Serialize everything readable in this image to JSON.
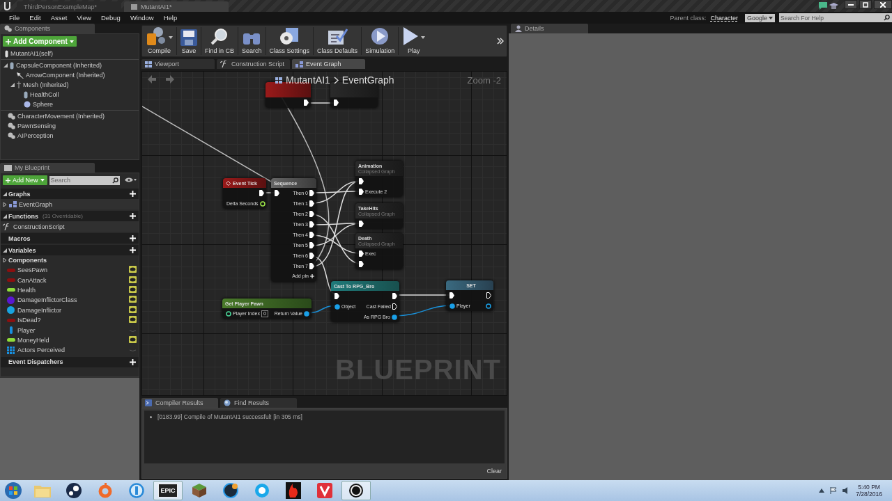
{
  "title_bar": {
    "tabs": [
      {
        "label": "ThirdPersonExampleMap*",
        "selected": false
      },
      {
        "label": "MutantAI1*",
        "selected": true
      }
    ]
  },
  "menu": [
    "File",
    "Edit",
    "Asset",
    "View",
    "Debug",
    "Window",
    "Help"
  ],
  "parent_class": {
    "label": "Parent class:",
    "value": "Character"
  },
  "help_search": {
    "provider": "Google",
    "placeholder": "Search For Help"
  },
  "components": {
    "tab": "Components",
    "add_button": "Add Component",
    "self": {
      "label": "MutantAI1(self)",
      "kind": "actor"
    },
    "scene_tree": [
      {
        "label": "CapsuleComponent (Inherited)",
        "kind": "capsule",
        "expanded": true,
        "children": [
          {
            "label": "ArrowComponent (Inherited)",
            "kind": "arrow"
          },
          {
            "label": "Mesh (Inherited)",
            "kind": "mesh",
            "expanded": true,
            "children": [
              {
                "label": "HealthColl",
                "kind": "capsule"
              },
              {
                "label": "Sphere",
                "kind": "sphere"
              }
            ]
          }
        ]
      }
    ],
    "other": [
      {
        "label": "CharacterMovement (Inherited)",
        "kind": "gear"
      },
      {
        "label": "PawnSensing",
        "kind": "gear"
      },
      {
        "label": "AIPerception",
        "kind": "gear"
      }
    ]
  },
  "my_blueprint": {
    "tab": "My Blueprint",
    "add_button": "Add New",
    "search_placeholder": "Search",
    "sections": [
      {
        "title": "Graphs",
        "expanded": true,
        "items": [
          {
            "label": "EventGraph",
            "kind": "graph",
            "expanded": false
          }
        ]
      },
      {
        "title": "Functions",
        "note": "(31 Overridable)",
        "expanded": true,
        "items": [
          {
            "label": "ConstructionScript",
            "kind": "function"
          }
        ]
      },
      {
        "title": "Macros"
      },
      {
        "title": "Variables",
        "expanded": true,
        "category": {
          "title": "Components",
          "expanded": false
        },
        "variables": [
          {
            "name": "SeesPawn",
            "kind": "pill",
            "color": "#8a1010",
            "public": true
          },
          {
            "name": "CanAttack",
            "kind": "pill",
            "color": "#8a1010",
            "public": true
          },
          {
            "name": "Health",
            "kind": "pill",
            "color": "#8fdc3a",
            "public": true
          },
          {
            "name": "DamageInflictorClass",
            "kind": "dot",
            "color": "#5a18d0",
            "public": true
          },
          {
            "name": "DamageInflictor",
            "kind": "dot",
            "color": "#18a4e0",
            "public": true
          },
          {
            "name": "IsDead?",
            "kind": "pill",
            "color": "#8a1010",
            "public": true
          },
          {
            "name": "Player",
            "kind": "capsule",
            "color": "#1890e0",
            "public": false
          },
          {
            "name": "MoneyHeld",
            "kind": "pill",
            "color": "#8fdc3a",
            "public": true
          },
          {
            "name": "Actors Perceived",
            "kind": "array",
            "color": "#1890e0",
            "public": false
          }
        ]
      },
      {
        "title": "Event Dispatchers"
      }
    ]
  },
  "toolbar": [
    {
      "label": "Compile",
      "kind": "compile",
      "dropdown": true
    },
    {
      "label": "Save",
      "kind": "save",
      "dropdown": false
    },
    {
      "label": "Find in CB",
      "kind": "find",
      "dropdown": false
    },
    {
      "label": "Search",
      "kind": "binoculars",
      "dropdown": false
    },
    {
      "label": "Class Settings",
      "kind": "settings",
      "dropdown": false
    },
    {
      "label": "Class Defaults",
      "kind": "defaults",
      "dropdown": false
    },
    {
      "label": "Simulation",
      "kind": "simulation",
      "dropdown": false
    },
    {
      "label": "Play",
      "kind": "play",
      "dropdown": true
    }
  ],
  "graph_tabs": [
    {
      "label": "Viewport",
      "kind": "viewport",
      "selected": false
    },
    {
      "label": "Construction Script",
      "kind": "function",
      "selected": false
    },
    {
      "label": "Event Graph",
      "kind": "graph",
      "selected": true
    }
  ],
  "graph": {
    "breadcrumb": [
      "MutantAI1",
      "EventGraph"
    ],
    "zoom": "Zoom -2",
    "watermark": "BLUEPRINT",
    "nodes": [
      {
        "kind": "custom_event",
        "rows": [
          {
            "right": {
              "kind": "exec",
              "linked": true
            }
          }
        ]
      },
      {
        "kind": "collapsed",
        "rows": [
          {
            "left": {
              "kind": "exec",
              "linked": true
            }
          }
        ]
      },
      {
        "kind": "event",
        "title": "Event Tick",
        "rows": [
          {
            "right": {
              "kind": "exec",
              "linked": true
            }
          },
          {
            "right": {
              "kind": "float",
              "label": "Delta Seconds",
              "linked": false
            }
          }
        ]
      },
      {
        "kind": "sequence",
        "title": "Sequence",
        "add_pin": "Add pin",
        "rows": [
          {
            "left": {
              "kind": "exec",
              "linked": true
            },
            "right": {
              "kind": "exec",
              "label": "Then 0",
              "linked": true
            }
          },
          {
            "right": {
              "kind": "exec",
              "label": "Then 1",
              "linked": true
            }
          },
          {
            "right": {
              "kind": "exec",
              "label": "Then 2",
              "linked": true
            }
          },
          {
            "right": {
              "kind": "exec",
              "label": "Then 3",
              "linked": true
            }
          },
          {
            "right": {
              "kind": "exec",
              "label": "Then 4",
              "linked": true
            }
          },
          {
            "right": {
              "kind": "exec",
              "label": "Then 5",
              "linked": true
            }
          },
          {
            "right": {
              "kind": "exec",
              "label": "Then 6",
              "linked": true
            }
          },
          {
            "right": {
              "kind": "exec",
              "label": "Then 7",
              "linked": true
            }
          }
        ]
      },
      {
        "kind": "collapsed",
        "title": "Animation",
        "subtitle": "Collapsed Graph",
        "rows": [
          {
            "left": {
              "kind": "exec",
              "linked": true
            }
          },
          {
            "left": {
              "kind": "exec",
              "label": "Execute 2",
              "linked": true
            }
          }
        ]
      },
      {
        "kind": "collapsed",
        "title": "TakeHits",
        "subtitle": "Collapsed Graph",
        "rows": [
          {
            "left": {
              "kind": "exec",
              "linked": true
            }
          }
        ]
      },
      {
        "kind": "collapsed",
        "title": "Death",
        "subtitle": "Collapsed Graph",
        "rows": [
          {
            "left": {
              "kind": "exec",
              "label": "Exec",
              "linked": true
            }
          },
          {
            "left": {
              "kind": "exec",
              "linked": true
            }
          }
        ]
      },
      {
        "kind": "function",
        "title": "Get Player Pawn",
        "rows": [
          {
            "left": {
              "kind": "int",
              "label": "Player Index",
              "value": "0",
              "linked": false
            },
            "right": {
              "kind": "object",
              "label": "Return Value",
              "linked": true
            }
          }
        ]
      },
      {
        "kind": "cast",
        "title": "Cast To RPG_Bro",
        "rows": [
          {
            "left": {
              "kind": "exec",
              "linked": true
            },
            "right": {
              "kind": "exec",
              "linked": true
            }
          },
          {
            "left": {
              "kind": "object",
              "label": "Object",
              "linked": true
            },
            "right": {
              "kind": "exec",
              "label": "Cast Failed",
              "linked": false
            }
          },
          {
            "right": {
              "kind": "object",
              "label": "As RPG Bro",
              "linked": true
            }
          }
        ]
      },
      {
        "kind": "set",
        "title": "SET",
        "rows": [
          {
            "left": {
              "kind": "exec",
              "linked": true
            },
            "right": {
              "kind": "exec",
              "linked": false
            }
          },
          {
            "left": {
              "kind": "object",
              "label": "Player",
              "linked": true
            },
            "right": {
              "kind": "object",
              "linked": false
            }
          }
        ]
      }
    ]
  },
  "results": {
    "tabs": [
      {
        "label": "Compiler Results",
        "kind": "console",
        "selected": true
      },
      {
        "label": "Find Results",
        "kind": "find",
        "selected": false
      }
    ],
    "messages": [
      "[0183.99] Compile of MutantAI1 successful! [in 305 ms]"
    ],
    "clear": "Clear"
  },
  "details": {
    "tab": "Details"
  },
  "taskbar": {
    "apps": [
      {
        "kind": "folder",
        "active": false
      },
      {
        "kind": "disc",
        "active": false
      },
      {
        "kind": "orange-ring",
        "active": false
      },
      {
        "kind": "blue-ring",
        "active": false
      },
      {
        "kind": "badge",
        "label": "EPIC",
        "active": true
      },
      {
        "kind": "cube",
        "active": false
      },
      {
        "kind": "blue-disc",
        "active": false
      },
      {
        "kind": "cloud",
        "active": false
      },
      {
        "kind": "flame",
        "active": false
      },
      {
        "kind": "red-square",
        "active": false
      },
      {
        "kind": "ue",
        "active": true
      }
    ],
    "time": "5:40 PM",
    "date": "7/28/2016"
  }
}
